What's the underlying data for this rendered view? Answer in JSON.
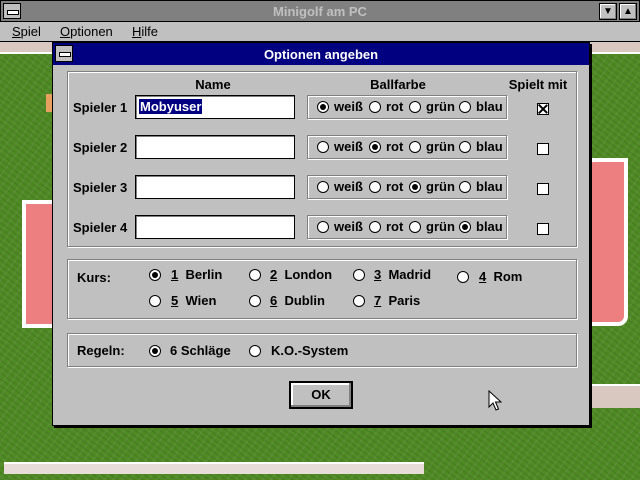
{
  "window": {
    "title": "Minigolf am PC"
  },
  "menu": [
    {
      "label": "Spiel",
      "accel": "S",
      "rest": "piel"
    },
    {
      "label": "Optionen",
      "accel": "O",
      "rest": "ptionen"
    },
    {
      "label": "Hilfe",
      "accel": "H",
      "rest": "ilfe"
    }
  ],
  "dialog": {
    "title": "Optionen angeben",
    "columns": {
      "name": "Name",
      "ballfarbe": "Ballfarbe",
      "spielt_mit": "Spielt mit"
    },
    "colors": [
      "weiß",
      "rot",
      "grün",
      "blau"
    ],
    "players": [
      {
        "label": "Spieler 1",
        "name": "Mobyuser",
        "color": "weiß",
        "plays": true
      },
      {
        "label": "Spieler 2",
        "name": "",
        "color": "rot",
        "plays": false
      },
      {
        "label": "Spieler 3",
        "name": "",
        "color": "grün",
        "plays": false
      },
      {
        "label": "Spieler 4",
        "name": "",
        "color": "blau",
        "plays": false
      }
    ],
    "kurs": {
      "label": "Kurs:",
      "selected": "Berlin",
      "options": [
        {
          "num": "1",
          "name": "Berlin"
        },
        {
          "num": "2",
          "name": "London"
        },
        {
          "num": "3",
          "name": "Madrid"
        },
        {
          "num": "4",
          "name": "Rom"
        },
        {
          "num": "5",
          "name": "Wien"
        },
        {
          "num": "6",
          "name": "Dublin"
        },
        {
          "num": "7",
          "name": "Paris"
        }
      ]
    },
    "regeln": {
      "label": "Regeln:",
      "selected": "6 Schläge",
      "options": [
        "6 Schläge",
        "K.O.-System"
      ]
    },
    "ok_label": "OK"
  },
  "colors": {
    "title_active": "#000080",
    "title_inactive": "#808080",
    "face": "#c0c0c0",
    "grass": "#4f8a25",
    "pink": "#ee7f80"
  }
}
